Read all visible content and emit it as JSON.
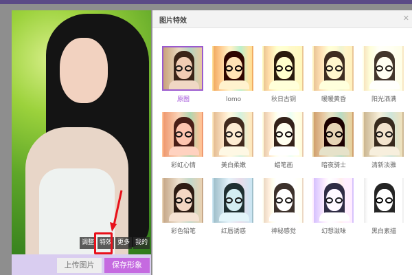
{
  "editor": {
    "tools": [
      "调整",
      "特效",
      "更多",
      "我的"
    ],
    "active_tool": "特效",
    "upload_label": "上传图片",
    "save_label": "保存形象"
  },
  "dialog": {
    "title": "图片特效",
    "close_icon": "close-icon",
    "selected": "原图",
    "effects": [
      "原图",
      "lomo",
      "秋日古铜",
      "暖暖黄昏",
      "阳光洒满",
      "彩虹心情",
      "美白柔嫩",
      "蜡笔画",
      "暗夜骑士",
      "清新淡雅",
      "彩色铅笔",
      "红唇诱惑",
      "神秘感觉",
      "幻想滋味",
      "黑白素描"
    ]
  },
  "colors": {
    "accent": "#c56ae0",
    "highlight": "#e8101a",
    "selected_border": "#9a5ad0"
  }
}
